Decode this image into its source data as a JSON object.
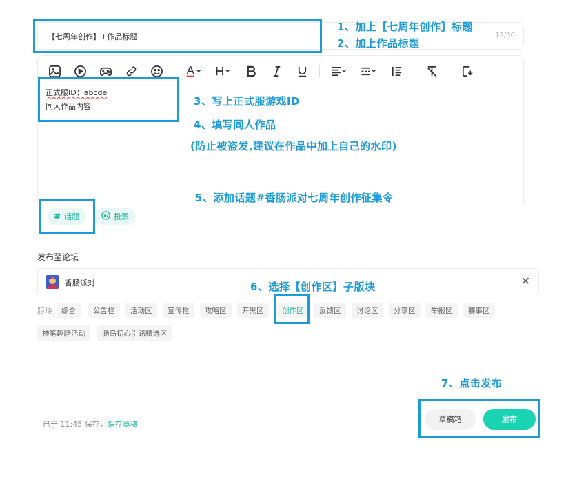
{
  "title_input": {
    "value": "【七周年创作】+作品标题",
    "counter": "12/30"
  },
  "editor": {
    "toolbar": [
      {
        "name": "image-icon"
      },
      {
        "name": "video-icon"
      },
      {
        "name": "game-icon"
      },
      {
        "name": "link-icon"
      },
      {
        "name": "emoji-icon"
      },
      {
        "name": "text-color-icon"
      },
      {
        "name": "heading-icon"
      },
      {
        "name": "bold-icon"
      },
      {
        "name": "italic-icon"
      },
      {
        "name": "underline-icon"
      },
      {
        "name": "align-icon"
      },
      {
        "name": "divider-icon"
      },
      {
        "name": "list-icon"
      },
      {
        "name": "clear-format-icon"
      },
      {
        "name": "redo-icon"
      }
    ],
    "content_lines": [
      "正式服ID：abcde",
      "同人作品内容"
    ]
  },
  "chips": {
    "topic": "话题",
    "vote": "投票"
  },
  "forum": {
    "label": "发布至论坛",
    "name": "香肠派对",
    "close_glyph": "✕"
  },
  "boards": {
    "label": "版块",
    "tags": [
      "综合",
      "公告栏",
      "活动区",
      "宣传栏",
      "攻略区",
      "开黑区",
      "创作区",
      "反馈区",
      "讨论区",
      "分享区",
      "举报区",
      "赛事区",
      "神笔趣肠活动",
      "肠岛初心引路精选区"
    ],
    "selected": "创作区"
  },
  "footer": {
    "saved_prefix": "已于 11:45 保存，",
    "saved_link": "保存草稿",
    "draft_button": "草稿箱",
    "publish_button": "发布"
  },
  "annotations": {
    "n1": "1、加上【七周年创作】标题",
    "n2": "2、加上作品标题",
    "n3": "3、写上正式服游戏ID",
    "n4": "4、填写同人作品",
    "n4b": "(防止被盗发,建议在作品中加上自己的水印)",
    "n5": "5、添加话题#香肠派对七周年创作征集令",
    "n6": "6、选择【创作区】子版块",
    "n7": "7、点击发布"
  },
  "colors": {
    "accent": "#19d3b3",
    "accent_text": "#19b59c",
    "annotation": "#1b9bd8"
  }
}
